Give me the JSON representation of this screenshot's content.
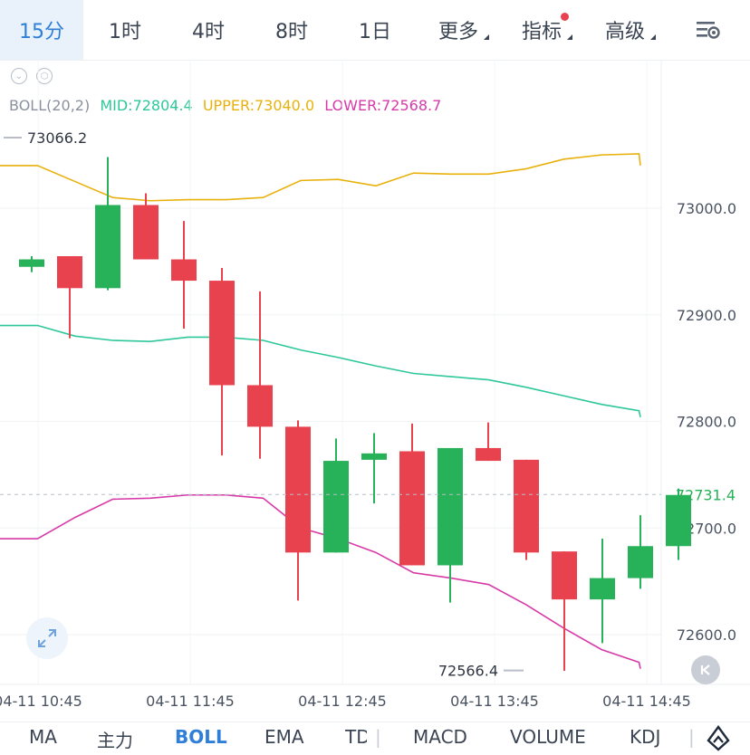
{
  "tabs": [
    {
      "label": "15分",
      "active": true
    },
    {
      "label": "1时"
    },
    {
      "label": "4时"
    },
    {
      "label": "8时"
    },
    {
      "label": "1日"
    },
    {
      "label": "更多",
      "dropdown": true
    },
    {
      "label": "指标",
      "dropdown": true,
      "badge": true
    },
    {
      "label": "高级",
      "dropdown": true
    }
  ],
  "legend": {
    "name": "BOLL(20,2)",
    "mid": "MID:72804.4",
    "upper": "UPPER:73040.0",
    "lower": "LOWER:72568.7",
    "colors": {
      "name": "#8a929e",
      "mid": "#2ec79a",
      "upper": "#e8b10c",
      "lower": "#d63aa8"
    }
  },
  "price_labels": {
    "high": "73066.2",
    "low": "72566.4",
    "current": "72731.4"
  },
  "indicators": [
    "MA",
    "主力",
    "BOLL",
    "EMA",
    "TD",
    "MACD",
    "VOLUME",
    "KDJ"
  ],
  "active_indicator": "BOLL",
  "chart_data": {
    "type": "candlestick",
    "y_ticks": [
      "73000.0",
      "72900.0",
      "72800.0",
      "72700.0",
      "72600.0"
    ],
    "y_tick_values": [
      73000,
      72900,
      72800,
      72700,
      72600
    ],
    "x_ticks": [
      "04-11 10:45",
      "04-11 11:45",
      "04-11 12:45",
      "04-11 13:45",
      "04-11 14:45"
    ],
    "ylim": [
      72540,
      73140
    ],
    "up_color": "#27b159",
    "down_color": "#e8424f",
    "candles": [
      {
        "t": 0,
        "o": 72945,
        "c": 72952,
        "h": 72955,
        "l": 72940
      },
      {
        "t": 1,
        "o": 72955,
        "c": 72925,
        "h": 72955,
        "l": 72878
      },
      {
        "t": 2,
        "o": 72925,
        "c": 73003,
        "h": 73048,
        "l": 72923
      },
      {
        "t": 3,
        "o": 73003,
        "c": 72952,
        "h": 73014,
        "l": 72952
      },
      {
        "t": 4,
        "o": 72952,
        "c": 72932,
        "h": 72988,
        "l": 72887
      },
      {
        "t": 5,
        "o": 72932,
        "c": 72834,
        "h": 72944,
        "l": 72768
      },
      {
        "t": 6,
        "o": 72834,
        "c": 72795,
        "h": 72922,
        "l": 72765
      },
      {
        "t": 7,
        "o": 72795,
        "c": 72677,
        "h": 72801,
        "l": 72632
      },
      {
        "t": 8,
        "o": 72677,
        "c": 72763,
        "h": 72784,
        "l": 72677
      },
      {
        "t": 9,
        "o": 72764,
        "c": 72770,
        "h": 72789,
        "l": 72723
      },
      {
        "t": 10,
        "o": 72772,
        "c": 72665,
        "h": 72798,
        "l": 72665
      },
      {
        "t": 11,
        "o": 72665,
        "c": 72775,
        "h": 72775,
        "l": 72630
      },
      {
        "t": 12,
        "o": 72775,
        "c": 72763,
        "h": 72799,
        "l": 72763
      },
      {
        "t": 13,
        "o": 72764,
        "c": 72677,
        "h": 72764,
        "l": 72670
      },
      {
        "t": 14,
        "o": 72678,
        "c": 72633,
        "h": 72678,
        "l": 72566
      },
      {
        "t": 15,
        "o": 72633,
        "c": 72653,
        "h": 72690,
        "l": 72592
      },
      {
        "t": 16,
        "o": 72653,
        "c": 72683,
        "h": 72712,
        "l": 72643
      },
      {
        "t": 17,
        "o": 72683,
        "c": 72731,
        "h": 72737,
        "l": 72670
      }
    ],
    "boll": {
      "upper": [
        73040,
        73040,
        73025,
        73010,
        73007,
        73008,
        73008,
        73010,
        73026,
        73027,
        73021,
        73033,
        73032,
        73032,
        73037,
        73046,
        73050,
        73051,
        73040
      ],
      "mid": [
        72890,
        72890,
        72880,
        72876,
        72875,
        72879,
        72879,
        72876,
        72867,
        72860,
        72852,
        72845,
        72842,
        72839,
        72832,
        72824,
        72816,
        72810,
        72804
      ],
      "lower": [
        72690,
        72690,
        72710,
        72727,
        72728,
        72731,
        72731,
        72728,
        72700,
        72690,
        72677,
        72658,
        72653,
        72647,
        72628,
        72606,
        72586,
        72574,
        72568
      ]
    }
  }
}
